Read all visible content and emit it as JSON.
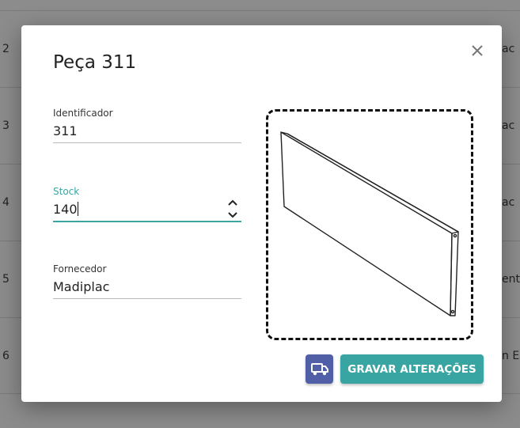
{
  "background_table": {
    "rows": [
      {
        "num": "2",
        "right": "ac"
      },
      {
        "num": "3",
        "right": "ac"
      },
      {
        "num": "4",
        "right": "ac"
      },
      {
        "num": "5",
        "right": "ent"
      },
      {
        "num": "6",
        "right": "n Es"
      }
    ]
  },
  "modal": {
    "title": "Peça 311",
    "fields": {
      "identificador": {
        "label": "Identificador",
        "value": "311"
      },
      "stock": {
        "label": "Stock",
        "value": "140"
      },
      "fornecedor": {
        "label": "Fornecedor",
        "value": "Madiplac"
      }
    },
    "save_label": "GRAVAR ALTERAÇÕES",
    "icons": {
      "close": "close-icon",
      "truck": "truck-icon"
    },
    "colors": {
      "accent": "#38a5a2",
      "truck_button": "#5160a6"
    }
  }
}
